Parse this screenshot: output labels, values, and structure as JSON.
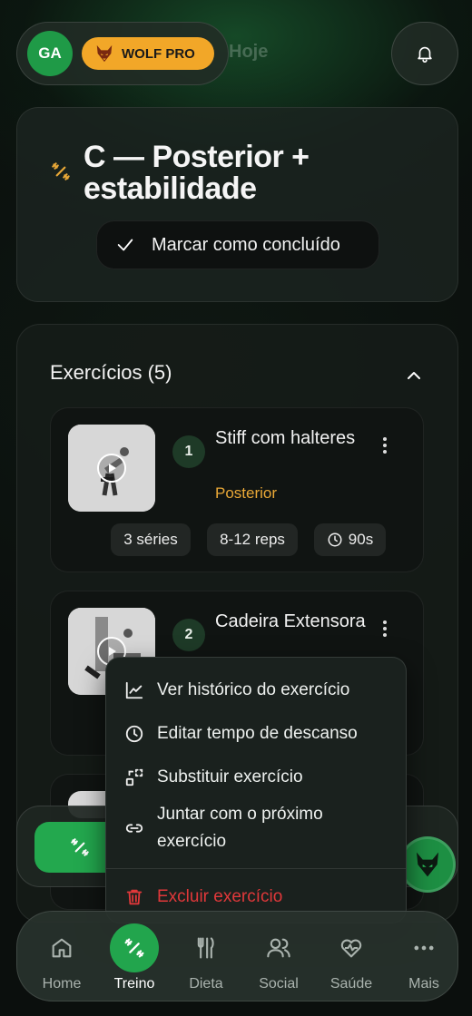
{
  "header": {
    "avatar_initials": "GA",
    "badge_label": "WOLF PRO",
    "hidden_title_fragment": "Hoje"
  },
  "workout": {
    "title": "C — Posterior + estabilidade",
    "complete_label": "Marcar como concluído"
  },
  "exercises": {
    "heading": "Exercícios (5)",
    "items": [
      {
        "number": "1",
        "name": "Stiff com halteres",
        "muscle": "Posterior",
        "sets": "3 séries",
        "reps": "8-12 reps",
        "rest": "90s"
      },
      {
        "number": "2",
        "name": "Cadeira Extensora",
        "muscle": "",
        "sets": "",
        "reps": "",
        "rest": ""
      }
    ]
  },
  "menu": {
    "items": [
      {
        "label": "Ver histórico do exercício",
        "icon": "chart-line-icon"
      },
      {
        "label": "Editar tempo de descanso",
        "icon": "clock-icon"
      },
      {
        "label": "Substituir exercício",
        "icon": "swap-icon"
      },
      {
        "label": "Juntar com o próximo exercício",
        "icon": "link-icon"
      },
      {
        "label": "Excluir exercício",
        "icon": "trash-icon"
      }
    ]
  },
  "nav": {
    "items": [
      {
        "label": "Home",
        "icon": "home-icon"
      },
      {
        "label": "Treino",
        "icon": "dumbbell-icon",
        "active": true
      },
      {
        "label": "Dieta",
        "icon": "cutlery-icon"
      },
      {
        "label": "Social",
        "icon": "users-icon"
      },
      {
        "label": "Saúde",
        "icon": "heart-pulse-icon"
      },
      {
        "label": "Mais",
        "icon": "more-icon"
      }
    ]
  },
  "colors": {
    "accent_green": "#22a54d",
    "badge_orange": "#f2a728",
    "muscle_orange": "#e9a837",
    "danger_red": "#e0383a"
  }
}
